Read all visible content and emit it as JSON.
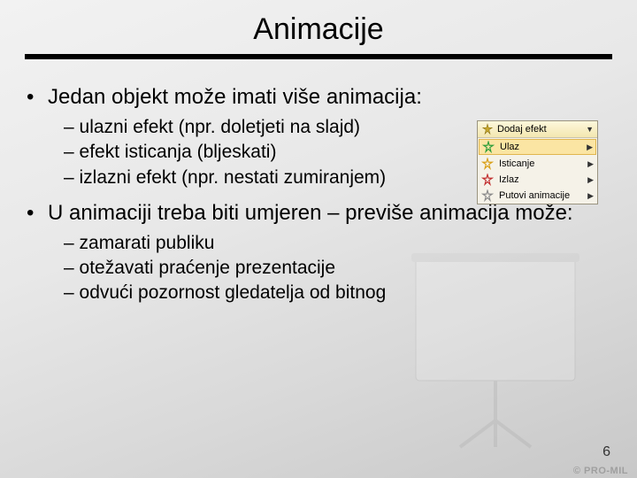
{
  "title": "Animacije",
  "bullets": [
    {
      "text": "Jedan objekt može imati više animacija:",
      "sub": [
        "– ulazni efekt (npr. doletjeti na slajd)",
        "– efekt isticanja (bljeskati)",
        "– izlazni efekt (npr. nestati zumiranjem)"
      ]
    },
    {
      "text": "U animaciji treba biti umjeren – previše animacija može:",
      "sub": [
        "– zamarati publiku",
        "– otežavati praćenje prezentacije",
        "– odvući pozornost gledatelja od bitnog"
      ]
    }
  ],
  "menu": {
    "header": "Dodaj efekt",
    "items": [
      {
        "label": "Ulaz",
        "color": "#2e9e3a",
        "selected": true
      },
      {
        "label": "Isticanje",
        "color": "#d9a017",
        "selected": false
      },
      {
        "label": "Izlaz",
        "color": "#c23030",
        "selected": false
      },
      {
        "label": "Putovi animacije",
        "color": "#8a8a8a",
        "selected": false
      }
    ]
  },
  "slide_number": "6",
  "watermark": "© PRO-MIL"
}
